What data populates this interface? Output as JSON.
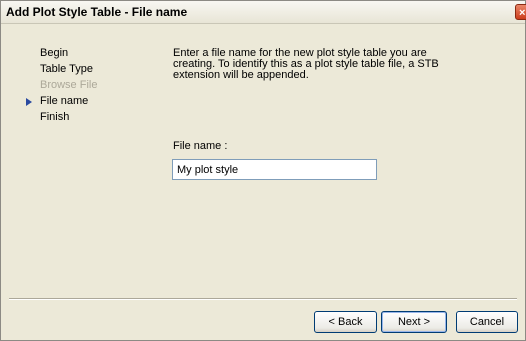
{
  "window": {
    "title": "Add Plot Style Table - File name",
    "close_glyph": "×"
  },
  "steps": [
    {
      "label": "Begin",
      "state": "done"
    },
    {
      "label": "Table Type",
      "state": "done"
    },
    {
      "label": "Browse File",
      "state": "disabled"
    },
    {
      "label": "File name",
      "state": "current"
    },
    {
      "label": "Finish",
      "state": "pending"
    }
  ],
  "main": {
    "description": "Enter a file name for the new plot style table you are creating. To identify this as a plot style table file, a STB extension will be appended.",
    "field_label": "File name :",
    "field_value": "My plot style"
  },
  "buttons": {
    "back": "< Back",
    "next": "Next >",
    "cancel": "Cancel"
  },
  "colors": {
    "window_bg": "#ece9d8",
    "step_arrow": "#2a4aa0",
    "disabled_text": "#aca899",
    "close_red": "#cc3d1c"
  }
}
